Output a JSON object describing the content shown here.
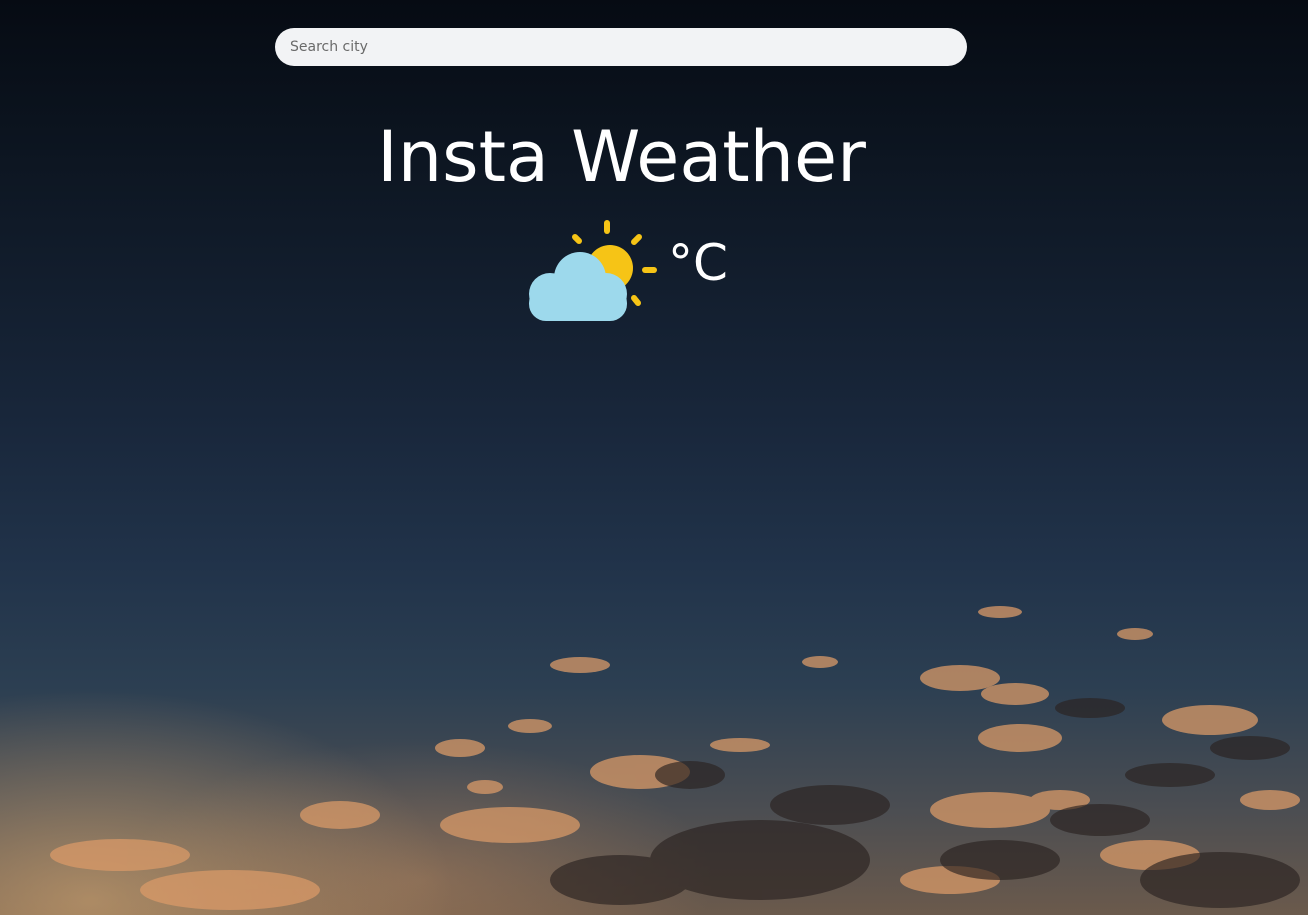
{
  "search": {
    "placeholder": "Search city",
    "value": ""
  },
  "header": {
    "title": "Insta Weather"
  },
  "weather": {
    "icon": "partly-cloudy-icon",
    "temperature": "",
    "unit": "°C"
  },
  "background": {
    "description": "dusk-sky-clouds"
  },
  "colors": {
    "sun": "#f6c416",
    "cloud": "#9dd9ec",
    "text": "#ffffff",
    "search_bg": "#f2f3f5"
  }
}
